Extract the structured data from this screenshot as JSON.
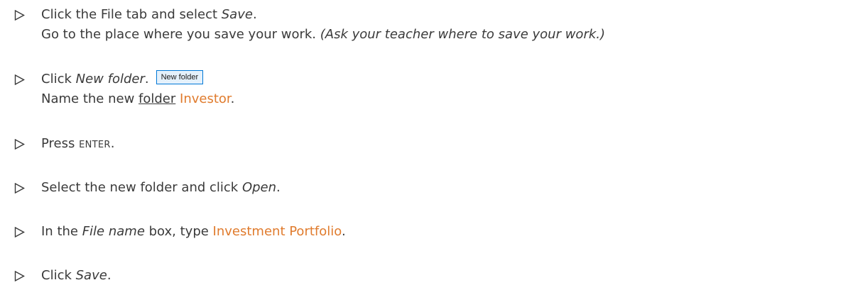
{
  "steps": [
    {
      "line1": {
        "t1": "Click the File tab and select ",
        "i1": "Save",
        "t2": "."
      },
      "line2": {
        "t1": "Go to the place where you save your work. ",
        "i1": "(Ask your teacher where to save your work.)"
      }
    },
    {
      "line1": {
        "t1": "Click ",
        "i1": "New folder",
        "t2": ".",
        "button": "New folder"
      },
      "line2": {
        "t1": "Name the new ",
        "u1": "folder",
        "t2": " ",
        "hl1": "Investor",
        "t3": "."
      }
    },
    {
      "line1": {
        "t1": "Press ",
        "key": "ENTER",
        "t2": "."
      }
    },
    {
      "line1": {
        "t1": "Select the new folder and click ",
        "i1": "Open",
        "t2": "."
      }
    },
    {
      "line1": {
        "t1": "In the ",
        "i1": "File name",
        "t2": " box, type ",
        "hl1": "Investment Portfolio",
        "t3": "."
      }
    },
    {
      "line1": {
        "t1": "Click ",
        "i1": "Save",
        "t2": "."
      }
    }
  ],
  "marker_icon": "triangle-right-outline-icon",
  "colors": {
    "text": "#3a3a3a",
    "highlight": "#e07b2d",
    "button_bg": "#e5f1fb",
    "button_border": "#0078d7"
  }
}
